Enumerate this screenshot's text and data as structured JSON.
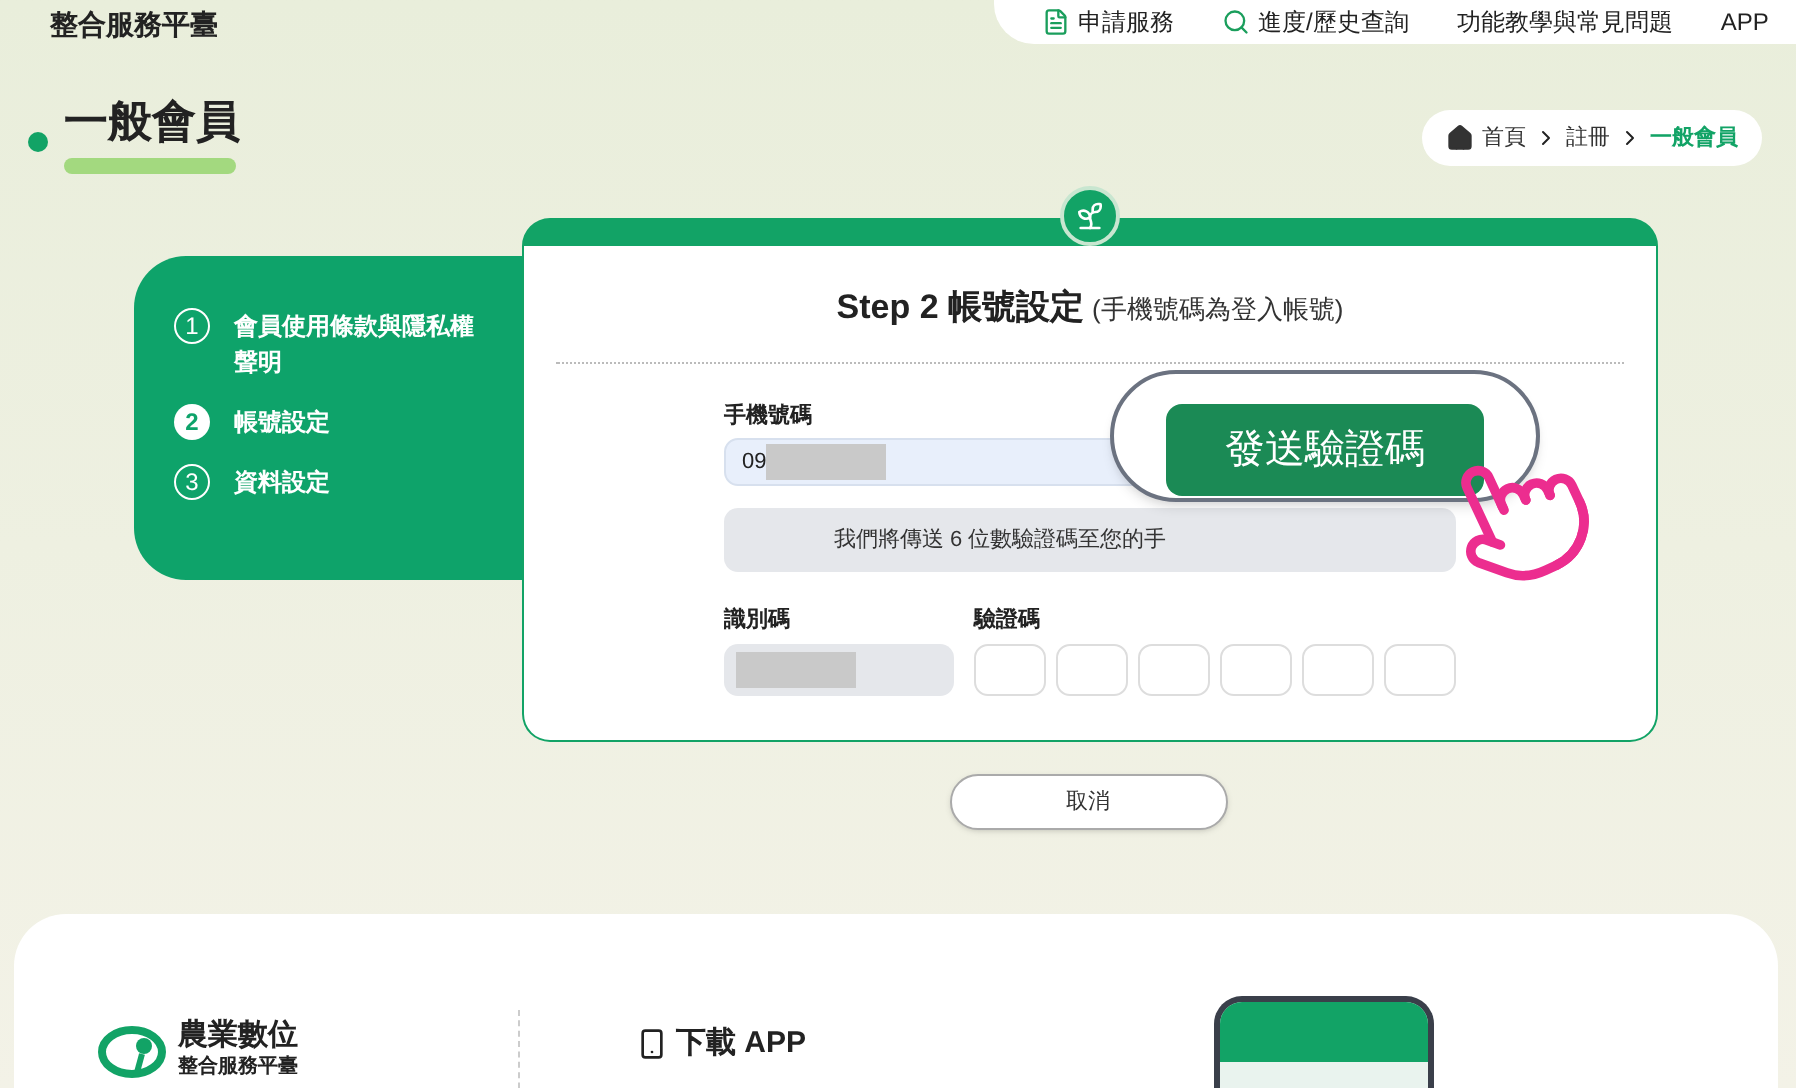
{
  "header": {
    "site_name": "整合服務平臺",
    "nav": [
      {
        "label": "申請服務",
        "kind": "doc"
      },
      {
        "label": "進度/歷史查詢",
        "kind": "search"
      },
      {
        "label": "功能教學與常見問題",
        "kind": "none"
      },
      {
        "label": "APP",
        "kind": "none"
      }
    ]
  },
  "page_title": "一般會員",
  "breadcrumb": [
    {
      "label": "首頁",
      "current": false
    },
    {
      "label": "註冊",
      "current": false
    },
    {
      "label": "一般會員",
      "current": true
    }
  ],
  "steps": [
    {
      "number": "1",
      "label": "會員使用條款與隱私權聲明",
      "selected": false
    },
    {
      "number": "2",
      "label": "帳號設定",
      "selected": true
    },
    {
      "number": "3",
      "label": "資料設定",
      "selected": false
    }
  ],
  "form": {
    "title": "Step 2 帳號設定",
    "subtitle": "(手機號碼為登入帳號)",
    "phone_label": "手機號碼",
    "phone_value": "09",
    "notice": "我們將傳送 6 位數驗證碼至您的手",
    "send_button": "發送驗證碼",
    "id_label": "識別碼",
    "code_label": "驗證碼"
  },
  "cancel_button": "取消",
  "footer": {
    "logo_line_1": "農業數位",
    "logo_line_2": "整合服務平臺",
    "download_title": "下載 APP"
  }
}
